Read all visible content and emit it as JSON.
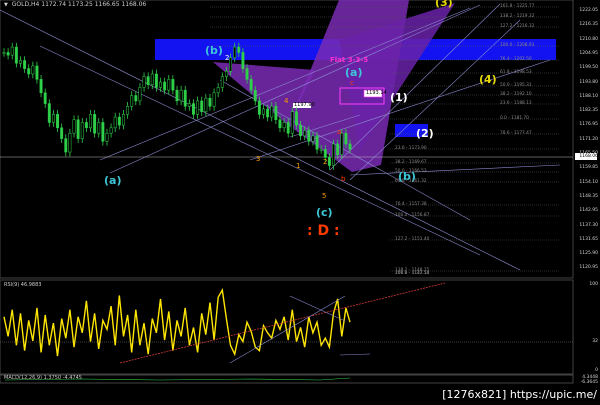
{
  "chart_header": {
    "symbol_timeframe": "GOLD,H4",
    "ohlc_values": "1172.74 1173.25 1166.65 1168.06"
  },
  "chart_data": [
    {
      "type": "line",
      "title": "",
      "xlabel": "",
      "ylabel": "",
      "ylim": [
        1120.95,
        1222.0
      ],
      "price_axis_ticks": [
        "1222.05",
        "1216.35",
        "1210.80",
        "1204.95",
        "1199.50",
        "1193.80",
        "1188.10",
        "1182.35",
        "1176.95",
        "1171.20",
        "1165.50",
        "1159.85",
        "1154.10",
        "1148.35",
        "1142.95",
        "1137.30",
        "1131.65",
        "1125.90",
        "1120.95"
      ],
      "current_price_label": "1168.06",
      "series": [
        {
          "values": [
            1204,
            1203,
            1206,
            1200,
            1201,
            1198,
            1196,
            1199,
            1194,
            1189,
            1185,
            1178,
            1181,
            1176,
            1172,
            1167,
            1174,
            1179,
            1172,
            1178,
            1176,
            1181,
            1174,
            1178,
            1171,
            1174,
            1176,
            1180,
            1177,
            1181,
            1184,
            1188,
            1186,
            1191,
            1195,
            1192,
            1196,
            1191,
            1193,
            1190,
            1194,
            1190,
            1186,
            1190,
            1184,
            1185,
            1181,
            1186,
            1182,
            1187,
            1184,
            1189,
            1191,
            1195,
            1197,
            1202,
            1206,
            1204,
            1198,
            1194,
            1190,
            1186,
            1181,
            1183,
            1180,
            1184,
            1179,
            1176,
            1178,
            1174,
            1182,
            1177,
            1173,
            1175,
            1171,
            1173,
            1168,
            1168,
            1165,
            1162,
            1170,
            1166,
            1174,
            1170,
            1168
          ]
        }
      ],
      "wave_labels": [
        {
          "text": "(a)",
          "color": "#3cc8d8"
        },
        {
          "text": "(b)",
          "color": "#3cc8d8"
        },
        {
          "text": "(c)",
          "color": "#3cc8d8"
        },
        {
          "text": "(a)",
          "color": "#3cc8d8"
        },
        {
          "text": "(b)",
          "color": "#3cc8d8"
        },
        {
          "text": "(1)",
          "color": "#ffffff"
        },
        {
          "text": "(2)",
          "color": "#ffffff"
        },
        {
          "text": "(3)",
          "color": "#e6d800"
        },
        {
          "text": "(4)",
          "color": "#e6d800"
        },
        {
          "text": ": D :",
          "color": "#ff3b00"
        },
        {
          "text": "Flat 3-3-5",
          "color": "#ff2fd0"
        }
      ],
      "minor_wave_labels": [
        "2",
        "4",
        "3",
        "5",
        "a",
        "b",
        "c",
        "1",
        "2"
      ],
      "box_labels": [
        "1197.90",
        "1193.14"
      ],
      "fib_levels": [
        "161.8 - 1225.77",
        "138.2 - 1219.32",
        "127.2 - 1216.32",
        "100.0 - 1208.93",
        "76.4 - 1202.50",
        "61.8 - 1198.53",
        "50.0 - 1195.31",
        "38.2 - 1192.10",
        "23.6 - 1188.13",
        "0.0 - 1181.70",
        "78.6 - 1177.47",
        "23.6 - 1173.90",
        "38.2 - 1169.67",
        "50.0 - 1166.53",
        "61.8 - 1161.32",
        "76.4 - 1157.38",
        "100.0 - 1156.87",
        "127.2 - 1151.40",
        "138.2 - 1148.75",
        "161.8 - 1142.51",
        "200.0 - 1137.10"
      ]
    },
    {
      "type": "line",
      "title": "",
      "indicator_label": "RSI(9) 46.9883",
      "ylim": [
        0,
        100
      ],
      "levels": [
        32
      ],
      "axis_ticks": [
        "100",
        "32",
        "0"
      ],
      "series": [
        {
          "values": [
            62,
            40,
            70,
            30,
            66,
            24,
            58,
            35,
            72,
            22,
            64,
            30,
            55,
            18,
            60,
            38,
            70,
            28,
            62,
            44,
            80,
            34,
            66,
            26,
            58,
            48,
            74,
            30,
            86,
            40,
            64,
            22,
            70,
            30,
            55,
            20,
            60,
            44,
            82,
            36,
            68,
            24,
            58,
            40,
            72,
            30,
            50,
            22,
            66,
            42,
            78,
            36,
            84,
            92,
            60,
            30,
            20,
            42,
            34,
            56,
            46,
            28,
            24,
            52,
            44,
            38,
            58,
            48,
            62,
            36,
            70,
            34,
            50,
            28,
            62,
            44,
            56,
            30,
            38,
            28,
            66,
            82,
            40,
            72,
            56
          ]
        }
      ]
    },
    {
      "type": "line",
      "title": "",
      "indicator_label": "MACD(12,26,9) 1.3750 -4.4745",
      "axis_ticks": [
        "4.3448",
        "-6.3645"
      ]
    }
  ],
  "watermark_text": "[1276x821] https://upic.me/"
}
